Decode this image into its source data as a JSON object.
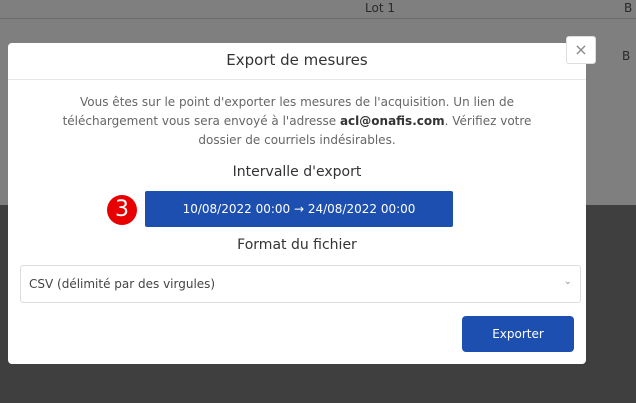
{
  "background": {
    "col_lot": "Lot 1",
    "col_b1": "B",
    "col_b2": "B"
  },
  "modal": {
    "title": "Export de mesures",
    "close_glyph": "×",
    "description_before": "Vous êtes sur le point d'exporter les mesures de l'acquisition. Un lien de téléchargement vous sera envoyé à l'adresse ",
    "email": "acl@onafis.com",
    "description_after": ". Vérifiez votre dossier de courriels indésirables.",
    "interval_label": "Intervalle d'export",
    "interval_value": "10/08/2022 00:00 → 24/08/2022 00:00",
    "badge_number": "3",
    "format_label": "Format du fichier",
    "format_selected": "CSV (délimité par des virgules)",
    "format_arrow": "⌄",
    "export_label": "Exporter"
  },
  "colors": {
    "primary": "#1d4fb0",
    "badge": "#e80000",
    "overlay": "#7f7f7f"
  },
  "icons": {
    "close": "close-icon",
    "dropdown": "chevron-down-icon"
  }
}
